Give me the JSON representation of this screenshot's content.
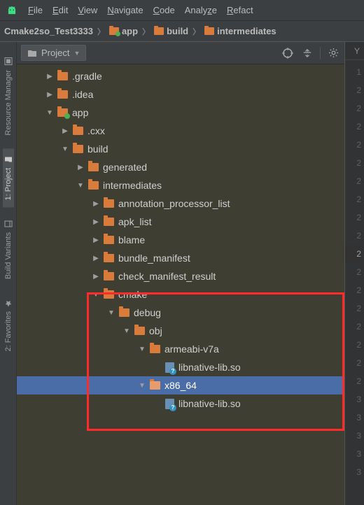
{
  "menu": {
    "items": [
      "File",
      "Edit",
      "View",
      "Navigate",
      "Code",
      "Analyze",
      "Refact"
    ]
  },
  "breadcrumbs": {
    "root": "Cmake2so_Test3333",
    "app": "app",
    "build": "build",
    "inter": "intermediates"
  },
  "panel": {
    "selector": "Project"
  },
  "sidetabs": {
    "rm": "Resource Manager",
    "proj": "1: Project",
    "bv": "Build Variants",
    "fav": "2: Favorites"
  },
  "tree": [
    {
      "depth": 0,
      "chev": "right",
      "icon": "fold",
      "label": ".gradle"
    },
    {
      "depth": 0,
      "chev": "right",
      "icon": "fold",
      "label": ".idea"
    },
    {
      "depth": 0,
      "chev": "down",
      "icon": "fold-green",
      "label": "app"
    },
    {
      "depth": 1,
      "chev": "right",
      "icon": "fold",
      "label": ".cxx"
    },
    {
      "depth": 1,
      "chev": "down",
      "icon": "fold",
      "label": "build"
    },
    {
      "depth": 2,
      "chev": "right",
      "icon": "fold",
      "label": "generated"
    },
    {
      "depth": 2,
      "chev": "down",
      "icon": "fold",
      "label": "intermediates"
    },
    {
      "depth": 3,
      "chev": "right",
      "icon": "fold",
      "label": "annotation_processor_list"
    },
    {
      "depth": 3,
      "chev": "right",
      "icon": "fold",
      "label": "apk_list"
    },
    {
      "depth": 3,
      "chev": "right",
      "icon": "fold",
      "label": "blame"
    },
    {
      "depth": 3,
      "chev": "right",
      "icon": "fold",
      "label": "bundle_manifest"
    },
    {
      "depth": 3,
      "chev": "right",
      "icon": "fold",
      "label": "check_manifest_result"
    },
    {
      "depth": 3,
      "chev": "down",
      "icon": "fold",
      "label": "cmake"
    },
    {
      "depth": 4,
      "chev": "down",
      "icon": "fold",
      "label": "debug"
    },
    {
      "depth": 5,
      "chev": "down",
      "icon": "fold",
      "label": "obj"
    },
    {
      "depth": 6,
      "chev": "down",
      "icon": "fold",
      "label": "armeabi-v7a"
    },
    {
      "depth": 7,
      "chev": "",
      "icon": "file",
      "label": "libnative-lib.so"
    },
    {
      "depth": 6,
      "chev": "down",
      "icon": "fold",
      "label": "x86_64",
      "selected": true
    },
    {
      "depth": 7,
      "chev": "",
      "icon": "file",
      "label": "libnative-lib.so"
    }
  ],
  "gutterHead": "Y",
  "gutter": [
    "1",
    "2",
    "2",
    "2",
    "2",
    "2",
    "2",
    "2",
    "2",
    "2",
    "2",
    "2",
    "2",
    "2",
    "2",
    "2",
    "2",
    "2",
    "3",
    "3",
    "3",
    "3",
    "3"
  ],
  "selectedGutterIndex": 10
}
